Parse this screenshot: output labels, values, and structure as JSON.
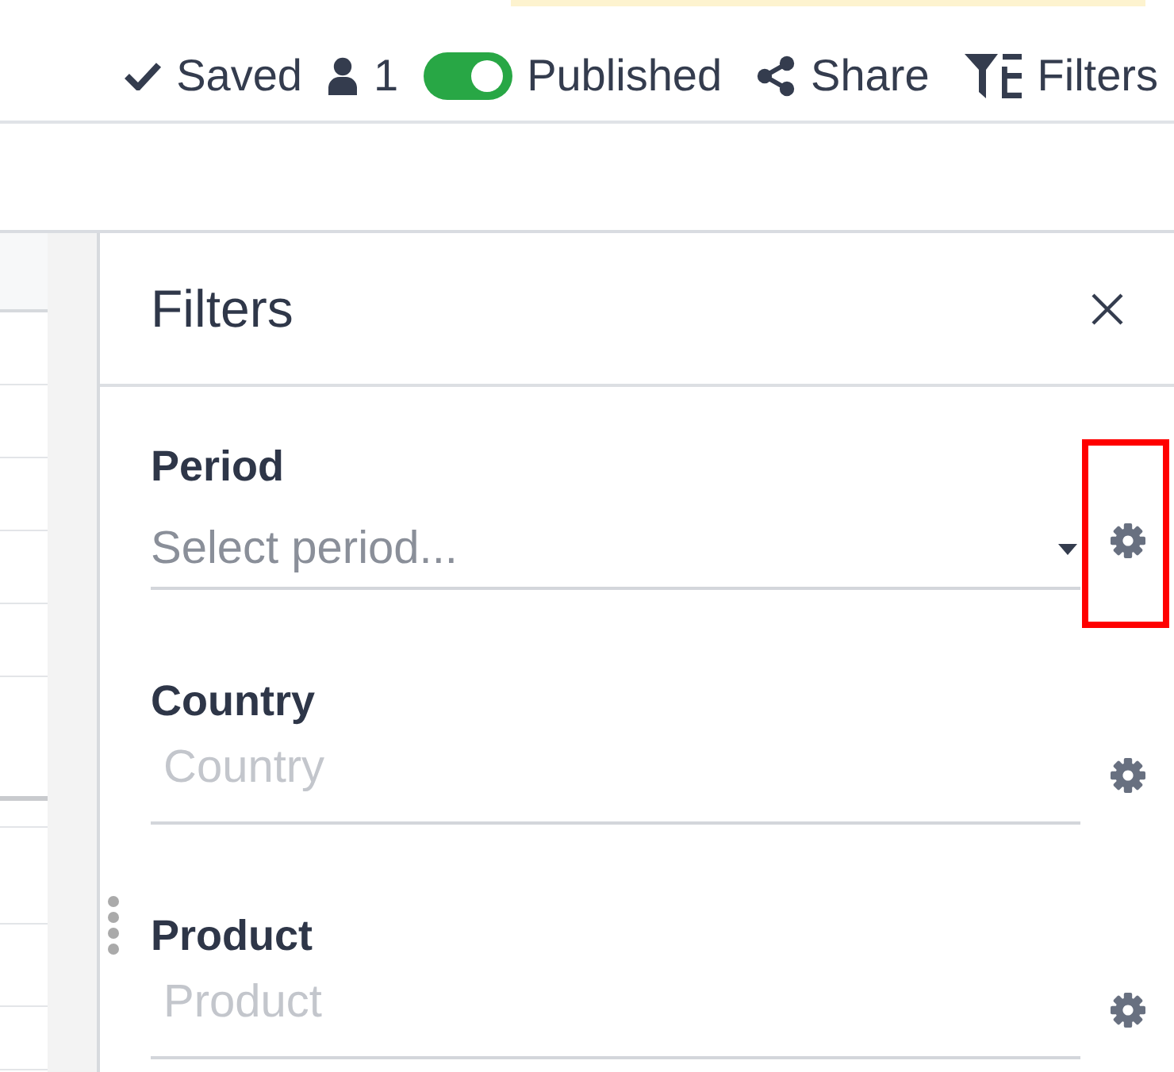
{
  "toolbar": [
    {
      "kind": "status",
      "label": "Saved"
    },
    {
      "kind": "users",
      "label": "1"
    },
    {
      "kind": "toggle",
      "label": "Published",
      "on": true
    },
    {
      "kind": "share",
      "label": "Share"
    },
    {
      "kind": "filters",
      "label": "Filters"
    }
  ],
  "panel": {
    "title": "Filters",
    "filters": [
      {
        "kind": "select",
        "label": "Period",
        "placeholder": "Select period...",
        "highlighted": true
      },
      {
        "kind": "text",
        "label": "Country",
        "placeholder": "Country",
        "highlighted": false
      },
      {
        "kind": "text",
        "label": "Product",
        "placeholder": "Product",
        "highlighted": false
      }
    ]
  }
}
